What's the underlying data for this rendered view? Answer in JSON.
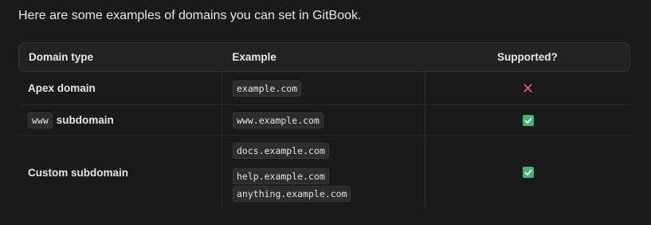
{
  "intro": "Here are some examples of domains you can set in GitBook.",
  "table": {
    "headers": [
      "Domain type",
      "Example",
      "Supported?"
    ],
    "rows": [
      {
        "type": "Apex domain",
        "examples": [
          "example.com"
        ],
        "supported": false
      },
      {
        "type_code": "www",
        "type": "subdomain",
        "examples": [
          "www.example.com"
        ],
        "supported": true
      },
      {
        "type": "Custom subdomain",
        "examples": [
          "docs.example.com",
          "help.example.com",
          "anything.example.com"
        ],
        "supported": true
      }
    ]
  },
  "icons": {
    "unsupported": "cross-icon",
    "supported": "checkbox-icon"
  },
  "colors": {
    "cross": "#f0506e",
    "check": "#3fb86b",
    "background": "#1a1a1a"
  }
}
